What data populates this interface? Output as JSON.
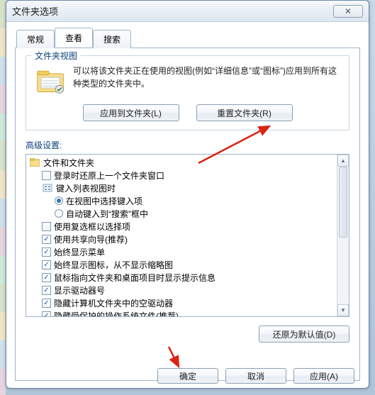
{
  "window": {
    "title": "文件夹选项"
  },
  "tabs": {
    "general": "常规",
    "view": "查看",
    "search": "搜索"
  },
  "groupbox": {
    "title": "文件夹视图",
    "desc": "可以将该文件夹正在使用的视图(例如“详细信息”或“图标”)应用到所有这种类型的文件夹中。",
    "applyBtn": "应用到文件夹(L)",
    "resetBtn": "重置文件夹(R)"
  },
  "advanced": {
    "title": "高级设置:",
    "rootLabel": "文件和文件夹",
    "items": [
      {
        "type": "checkbox",
        "checked": false,
        "label": "登录时还原上一个文件夹窗口"
      },
      {
        "type": "group",
        "label": "键入列表视图时"
      },
      {
        "type": "radio",
        "selected": true,
        "label": "在视图中选择键入项",
        "indent": 2
      },
      {
        "type": "radio",
        "selected": false,
        "label": "自动键入到“搜索”框中",
        "indent": 2
      },
      {
        "type": "checkbox",
        "checked": false,
        "label": "使用复选框以选择项"
      },
      {
        "type": "checkbox",
        "checked": true,
        "label": "使用共享向导(推荐)"
      },
      {
        "type": "checkbox",
        "checked": true,
        "label": "始终显示菜单"
      },
      {
        "type": "checkbox",
        "checked": true,
        "label": "始终显示图标，从不显示缩略图"
      },
      {
        "type": "checkbox",
        "checked": true,
        "label": "鼠标指向文件夹和桌面项目时显示提示信息"
      },
      {
        "type": "checkbox",
        "checked": true,
        "label": "显示驱动器号"
      },
      {
        "type": "checkbox",
        "checked": true,
        "label": "隐藏计算机文件夹中的空驱动器"
      },
      {
        "type": "checkbox",
        "checked": true,
        "label": "隐藏受保护的操作系统文件(推荐)"
      }
    ],
    "restoreBtn": "还原为默认值(D)"
  },
  "buttons": {
    "ok": "确定",
    "cancel": "取消",
    "apply": "应用(A)"
  }
}
